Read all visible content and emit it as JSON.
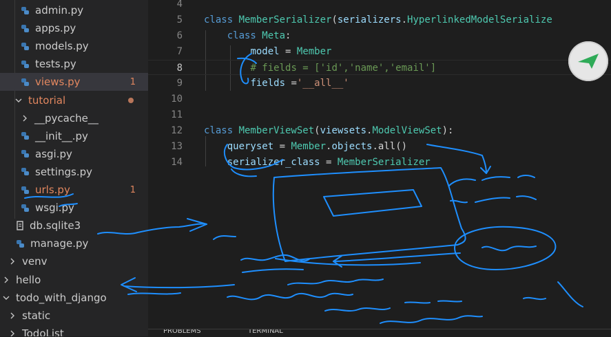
{
  "explorer": {
    "items": [
      {
        "type": "py",
        "label": "admin.py",
        "indent": 1
      },
      {
        "type": "py",
        "label": "apps.py",
        "indent": 1
      },
      {
        "type": "py",
        "label": "models.py",
        "indent": 1
      },
      {
        "type": "py",
        "label": "tests.py",
        "indent": 1
      },
      {
        "type": "py",
        "label": "views.py",
        "indent": 1,
        "modified": true,
        "selected": true,
        "badge": "1"
      },
      {
        "type": "folder-open",
        "label": "tutorial",
        "indent": 0,
        "modified_folder": true,
        "dot": true
      },
      {
        "type": "folder",
        "label": "__pycache__",
        "indent": 1
      },
      {
        "type": "py",
        "label": "__init__.py",
        "indent": 1
      },
      {
        "type": "py",
        "label": "asgi.py",
        "indent": 1
      },
      {
        "type": "py",
        "label": "settings.py",
        "indent": 1
      },
      {
        "type": "py",
        "label": "urls.py",
        "indent": 1,
        "modified": true,
        "badge": "1"
      },
      {
        "type": "py",
        "label": "wsgi.py",
        "indent": 1
      },
      {
        "type": "db",
        "label": "db.sqlite3",
        "indent": -1
      },
      {
        "type": "py",
        "label": "manage.py",
        "indent": -1
      },
      {
        "type": "folder",
        "label": "venv",
        "indent": -2
      },
      {
        "type": "folder",
        "label": "hello",
        "indent": -3
      },
      {
        "type": "folder-open",
        "label": "todo_with_django",
        "indent": -3
      },
      {
        "type": "folder",
        "label": "static",
        "indent": -2
      },
      {
        "type": "folder",
        "label": "TodoList",
        "indent": -2
      }
    ]
  },
  "editor": {
    "current_line": "8",
    "lines": [
      {
        "num": "4",
        "tokens": []
      },
      {
        "num": "5",
        "tokens": [
          [
            "kw",
            "class "
          ],
          [
            "cls",
            "MemberSerializer"
          ],
          [
            "txt",
            "("
          ],
          [
            "var",
            "serializers"
          ],
          [
            "txt",
            "."
          ],
          [
            "cls",
            "HyperlinkedModelSerialize"
          ]
        ]
      },
      {
        "num": "6",
        "tokens": [
          [
            "txt",
            "    "
          ],
          [
            "kw",
            "class "
          ],
          [
            "cls",
            "Meta"
          ],
          [
            "txt",
            ":"
          ]
        ]
      },
      {
        "num": "7",
        "tokens": [
          [
            "txt",
            "        "
          ],
          [
            "var",
            "model"
          ],
          [
            "txt",
            " = "
          ],
          [
            "cls",
            "Member"
          ]
        ]
      },
      {
        "num": "8",
        "tokens": [
          [
            "txt",
            "        "
          ],
          [
            "cmt",
            "# fields = ['id','name','email']"
          ]
        ]
      },
      {
        "num": "9",
        "tokens": [
          [
            "txt",
            "        "
          ],
          [
            "var",
            "fields"
          ],
          [
            "txt",
            " ="
          ],
          [
            "str",
            "'__all__'"
          ]
        ]
      },
      {
        "num": "10",
        "tokens": []
      },
      {
        "num": "11",
        "tokens": []
      },
      {
        "num": "12",
        "tokens": [
          [
            "kw",
            "class "
          ],
          [
            "cls",
            "MemberViewSet"
          ],
          [
            "txt",
            "("
          ],
          [
            "var",
            "viewsets"
          ],
          [
            "txt",
            "."
          ],
          [
            "cls",
            "ModelViewSet"
          ],
          [
            "txt",
            "):"
          ]
        ]
      },
      {
        "num": "13",
        "tokens": [
          [
            "txt",
            "    "
          ],
          [
            "var",
            "queryset"
          ],
          [
            "txt",
            " = "
          ],
          [
            "cls",
            "Member"
          ],
          [
            "txt",
            "."
          ],
          [
            "var",
            "objects"
          ],
          [
            "txt",
            "."
          ],
          [
            "txt",
            "all()"
          ]
        ]
      },
      {
        "num": "14",
        "tokens": [
          [
            "txt",
            "    "
          ],
          [
            "var",
            "serializer_class"
          ],
          [
            "txt",
            " = "
          ],
          [
            "cls",
            "MemberSerializer"
          ]
        ]
      }
    ]
  },
  "bottom_panel": {
    "tabs": [
      "PROBLEMS",
      "TERMINAL"
    ]
  },
  "colors": {
    "sidebar_bg": "#252526",
    "editor_bg": "#1e1e1e",
    "annotation_ink": "#1e8fff",
    "modified_text": "#e2875f"
  }
}
